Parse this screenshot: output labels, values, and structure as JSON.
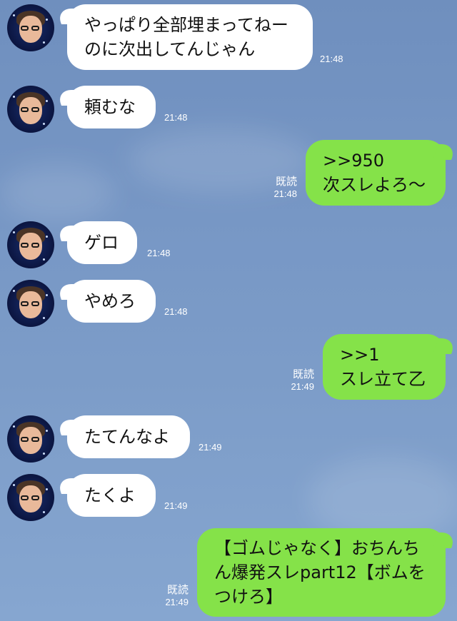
{
  "theme": {
    "incoming_bubble": "#ffffff",
    "outgoing_bubble": "#85e249",
    "background": "#7797c5"
  },
  "messages": [
    {
      "direction": "in",
      "text": "やっぱり全部埋まってねー\nのに次出してんじゃん",
      "time": "21:48"
    },
    {
      "direction": "in",
      "text": "頼むな",
      "time": "21:48"
    },
    {
      "direction": "out",
      "text": ">>950\n次スレよろ〜",
      "time": "21:48",
      "read": "既読"
    },
    {
      "direction": "in",
      "text": "ゲロ",
      "time": "21:48"
    },
    {
      "direction": "in",
      "text": "やめろ",
      "time": "21:48"
    },
    {
      "direction": "out",
      "text": ">>1\nスレ立て乙",
      "time": "21:49",
      "read": "既読"
    },
    {
      "direction": "in",
      "text": "たてんなよ",
      "time": "21:49"
    },
    {
      "direction": "in",
      "text": "たくよ",
      "time": "21:49"
    },
    {
      "direction": "out",
      "text": "【ゴムじゃなく】おちんち\nん爆発スレpart12【ボムを\nつけろ】",
      "time": "21:49",
      "read": "既読"
    }
  ]
}
